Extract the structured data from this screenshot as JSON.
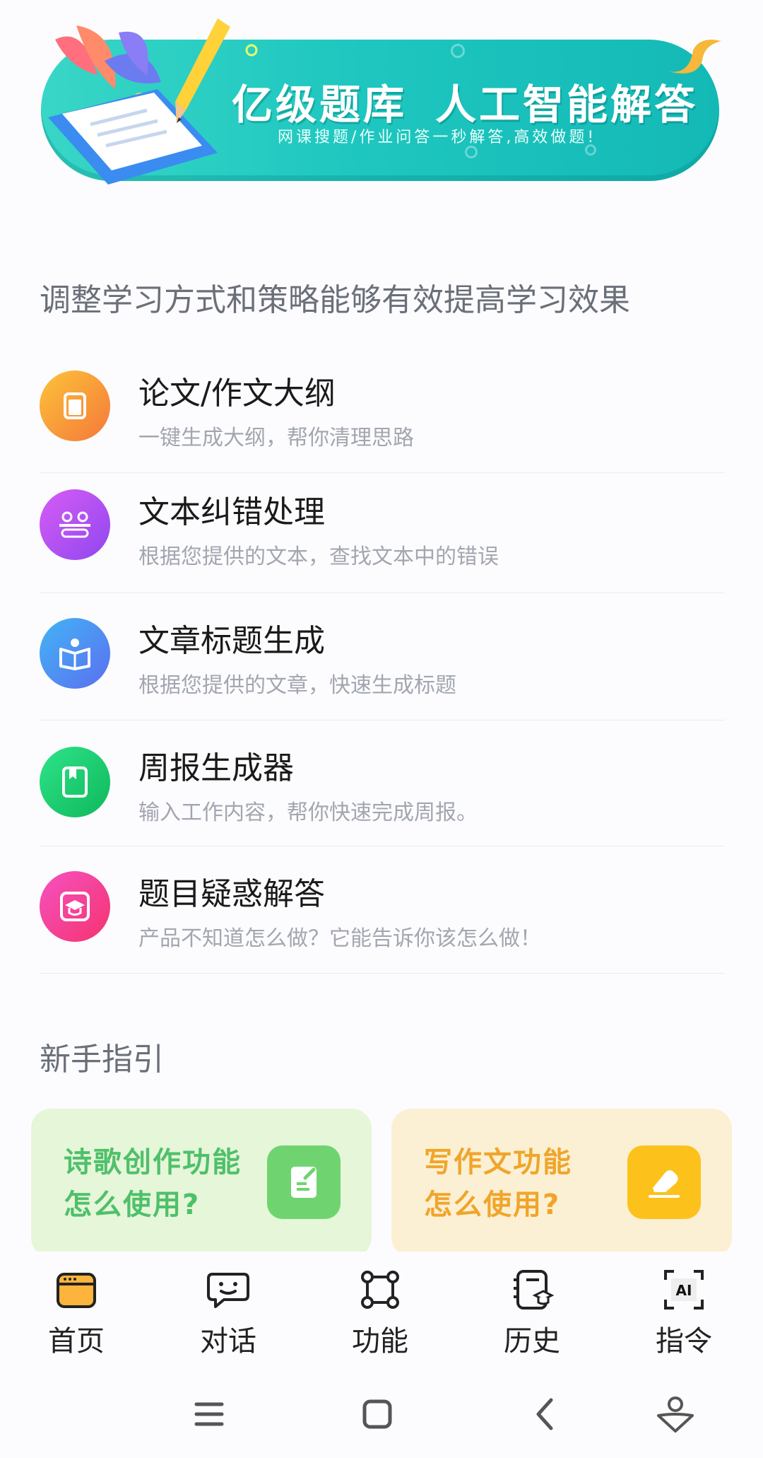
{
  "banner": {
    "title_left": "亿级题库",
    "title_right": "人工智能解答",
    "subtitle": "网课搜题/作业问答一秒解答,高效做题!"
  },
  "section_features": {
    "title": "调整学习方式和策略能够有效提高学习效果"
  },
  "features": [
    {
      "title": "论文/作文大纲",
      "desc": "一键生成大纲，帮你清理思路",
      "icon": "document-icon",
      "color": "#f59e32"
    },
    {
      "title": "文本纠错处理",
      "desc": "根据您提供的文本，查找文本中的错误",
      "icon": "text-correction-icon",
      "color": "#b44ef0"
    },
    {
      "title": "文章标题生成",
      "desc": "根据您提供的文章，快速生成标题",
      "icon": "book-reader-icon",
      "color": "#3d8ff5"
    },
    {
      "title": "周报生成器",
      "desc": "输入工作内容，帮你快速完成周报。",
      "icon": "notebook-icon",
      "color": "#1fcf6b"
    },
    {
      "title": "题目疑惑解答",
      "desc": "产品不知道怎么做？它能告诉你该怎么做！",
      "icon": "graduation-cap-icon",
      "color": "#f0407f"
    }
  ],
  "section_guide": {
    "title": "新手指引"
  },
  "guide_cards": [
    {
      "line1": "诗歌创作功能",
      "line2": "怎么使用?",
      "icon": "edit-document-icon",
      "bg": "#e6f6d9",
      "text_color": "#4fc06a",
      "icon_bg": "#6fd46f"
    },
    {
      "line1": "写作文功能",
      "line2": "怎么使用?",
      "icon": "eraser-pen-icon",
      "bg": "#fbf0d3",
      "text_color": "#f0a52a",
      "icon_bg": "#fcc21b"
    }
  ],
  "bottom_nav": [
    {
      "label": "首页",
      "icon": "browser-window-icon",
      "active": true
    },
    {
      "label": "对话",
      "icon": "chat-bubble-icon",
      "active": false
    },
    {
      "label": "功能",
      "icon": "nodes-icon",
      "active": false
    },
    {
      "label": "历史",
      "icon": "history-book-icon",
      "active": false
    },
    {
      "label": "指令",
      "icon": "ai-scan-icon",
      "active": false
    }
  ],
  "ai_icon_text": "AI",
  "system_nav": [
    "menu-icon",
    "home-square-icon",
    "back-chevron-icon",
    "assistant-icon"
  ],
  "colors": {
    "accent": "#fcb43c",
    "banner": "#1fc7c0"
  }
}
